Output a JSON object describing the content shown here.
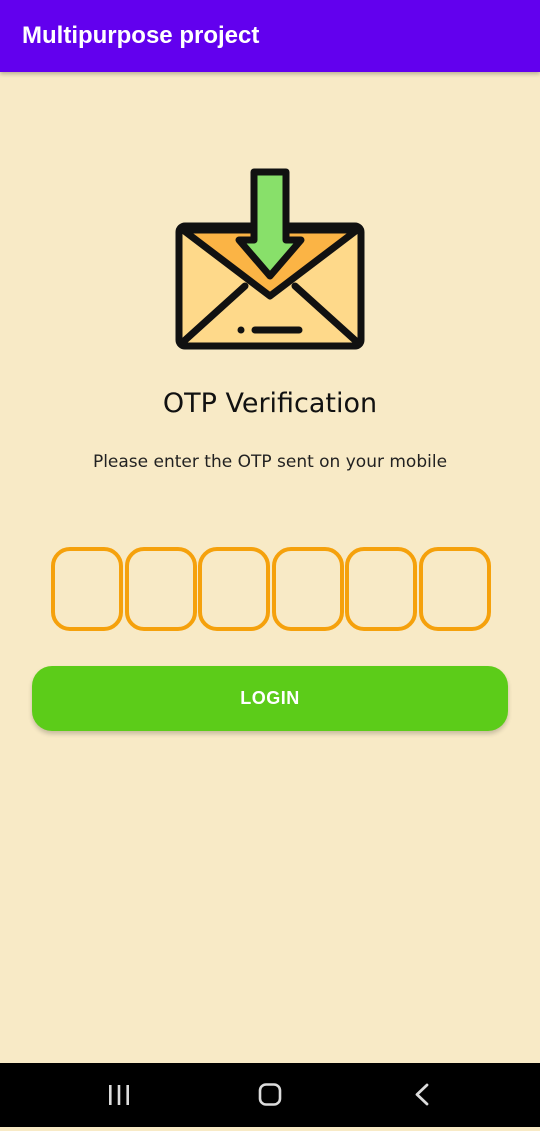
{
  "app_bar": {
    "title": "Multipurpose project",
    "color": "#6200ee"
  },
  "hero": {
    "icon": "envelope-download-icon",
    "title": "OTP Verification",
    "subtitle": "Please enter the OTP sent on your mobile"
  },
  "otp": {
    "digits": [
      "",
      "",
      "",
      "",
      "",
      ""
    ],
    "box_border_color": "#f5a10c"
  },
  "login": {
    "label": "LOGIN",
    "color": "#5ccc19"
  },
  "nav": {
    "recent_icon": "recent-apps-icon",
    "home_icon": "home-icon",
    "back_icon": "back-icon"
  },
  "colors": {
    "background": "#f8eac6"
  }
}
